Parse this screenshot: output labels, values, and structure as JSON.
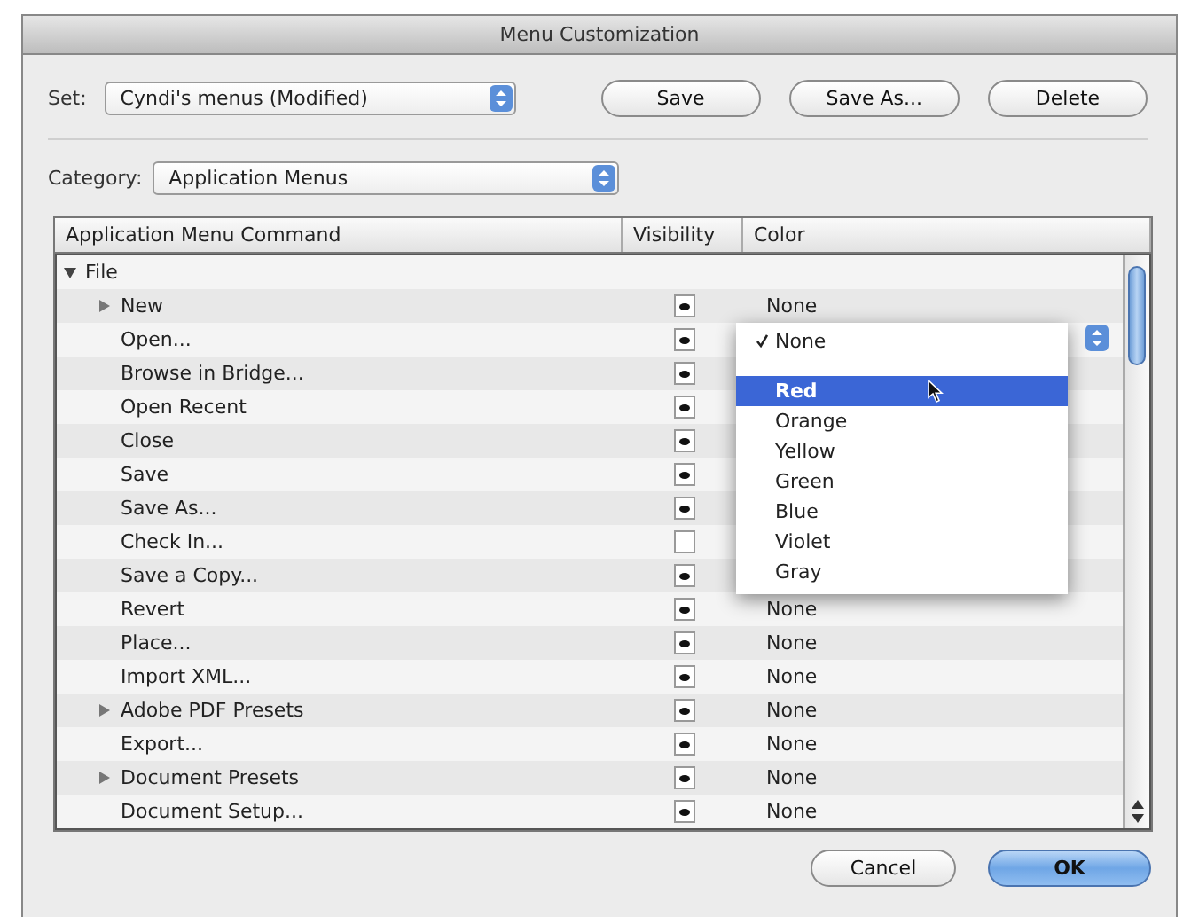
{
  "window": {
    "title": "Menu Customization"
  },
  "set": {
    "label": "Set:",
    "value": "Cyndi's menus (Modified)"
  },
  "set_buttons": [
    "Save",
    "Save As...",
    "Delete"
  ],
  "category": {
    "label": "Category:",
    "value": "Application Menus"
  },
  "table": {
    "columns": [
      "Application Menu Command",
      "Visibility",
      "Color"
    ],
    "rows": [
      {
        "label": "File",
        "expanded": true,
        "children": [
          {
            "label": "New",
            "expandable": true,
            "visible": true,
            "color_value": "None",
            "popup_open": false
          },
          {
            "label": "Open...",
            "expandable": false,
            "visible": true,
            "popup_open": true
          },
          {
            "label": "Browse in Bridge...",
            "expandable": false,
            "visible": true,
            "popup_open": false
          },
          {
            "label": "Open Recent",
            "expandable": false,
            "visible": true,
            "popup_open": false
          },
          {
            "label": "Close",
            "expandable": false,
            "visible": true,
            "popup_open": false
          },
          {
            "label": "Save",
            "expandable": false,
            "visible": true,
            "popup_open": false
          },
          {
            "label": "Save As...",
            "expandable": false,
            "visible": true,
            "popup_open": false
          },
          {
            "label": "Check In...",
            "expandable": false,
            "visible": false,
            "popup_open": false
          },
          {
            "label": "Save a Copy...",
            "expandable": false,
            "visible": true,
            "popup_open": false
          },
          {
            "label": "Revert",
            "expandable": false,
            "visible": true,
            "color_value": "None",
            "popup_open": false
          },
          {
            "label": "Place...",
            "expandable": false,
            "visible": true,
            "color_value": "None",
            "popup_open": false
          },
          {
            "label": "Import XML...",
            "expandable": false,
            "visible": true,
            "color_value": "None",
            "popup_open": false
          },
          {
            "label": "Adobe PDF Presets",
            "expandable": true,
            "visible": true,
            "color_value": "None",
            "popup_open": false
          },
          {
            "label": "Export...",
            "expandable": false,
            "visible": true,
            "color_value": "None",
            "popup_open": false
          },
          {
            "label": "Document Presets",
            "expandable": true,
            "visible": true,
            "color_value": "None",
            "popup_open": false
          },
          {
            "label": "Document Setup...",
            "expandable": false,
            "visible": true,
            "color_value": "None",
            "popup_open": false
          }
        ]
      }
    ]
  },
  "color_menu": {
    "items": [
      {
        "kind": "item",
        "label": "None",
        "checked": true,
        "selected": false
      },
      {
        "kind": "separator"
      },
      {
        "kind": "item",
        "label": "Red",
        "checked": false,
        "selected": true
      },
      {
        "kind": "item",
        "label": "Orange",
        "checked": false,
        "selected": false
      },
      {
        "kind": "item",
        "label": "Yellow",
        "checked": false,
        "selected": false
      },
      {
        "kind": "item",
        "label": "Green",
        "checked": false,
        "selected": false
      },
      {
        "kind": "item",
        "label": "Blue",
        "checked": false,
        "selected": false
      },
      {
        "kind": "item",
        "label": "Violet",
        "checked": false,
        "selected": false
      },
      {
        "kind": "item",
        "label": "Gray",
        "checked": false,
        "selected": false
      }
    ]
  },
  "buttons": [
    {
      "label": "Cancel",
      "default": false
    },
    {
      "label": "OK",
      "default": true
    }
  ]
}
